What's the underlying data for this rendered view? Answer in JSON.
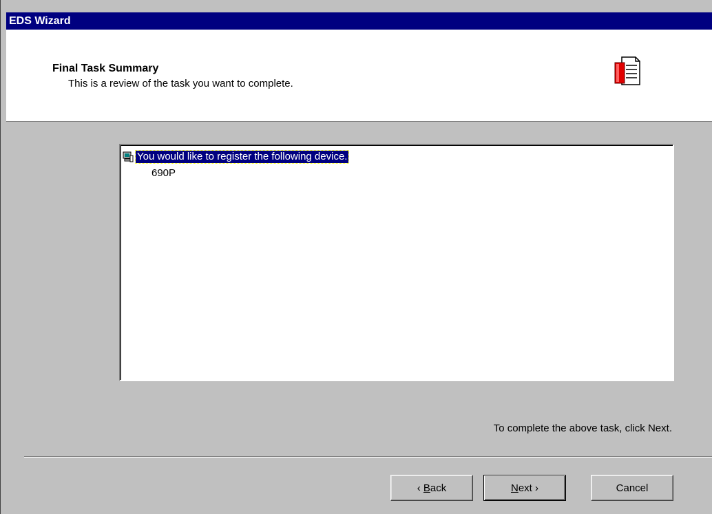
{
  "window": {
    "title": "EDS Wizard"
  },
  "header": {
    "title": "Final Task Summary",
    "subtitle": "This is a review of the task you want to complete.",
    "icon": "document-icon"
  },
  "summary": {
    "row_text": "You would like to register the following device.",
    "row_icon": "computer-icon",
    "device": "690P"
  },
  "hint": "To complete the above task, click Next.",
  "buttons": {
    "back": {
      "arrow": "‹",
      "mnemonic": "B",
      "rest": "ack"
    },
    "next": {
      "mnemonic": "N",
      "rest": "ext",
      "arrow": "›"
    },
    "cancel": "Cancel"
  }
}
